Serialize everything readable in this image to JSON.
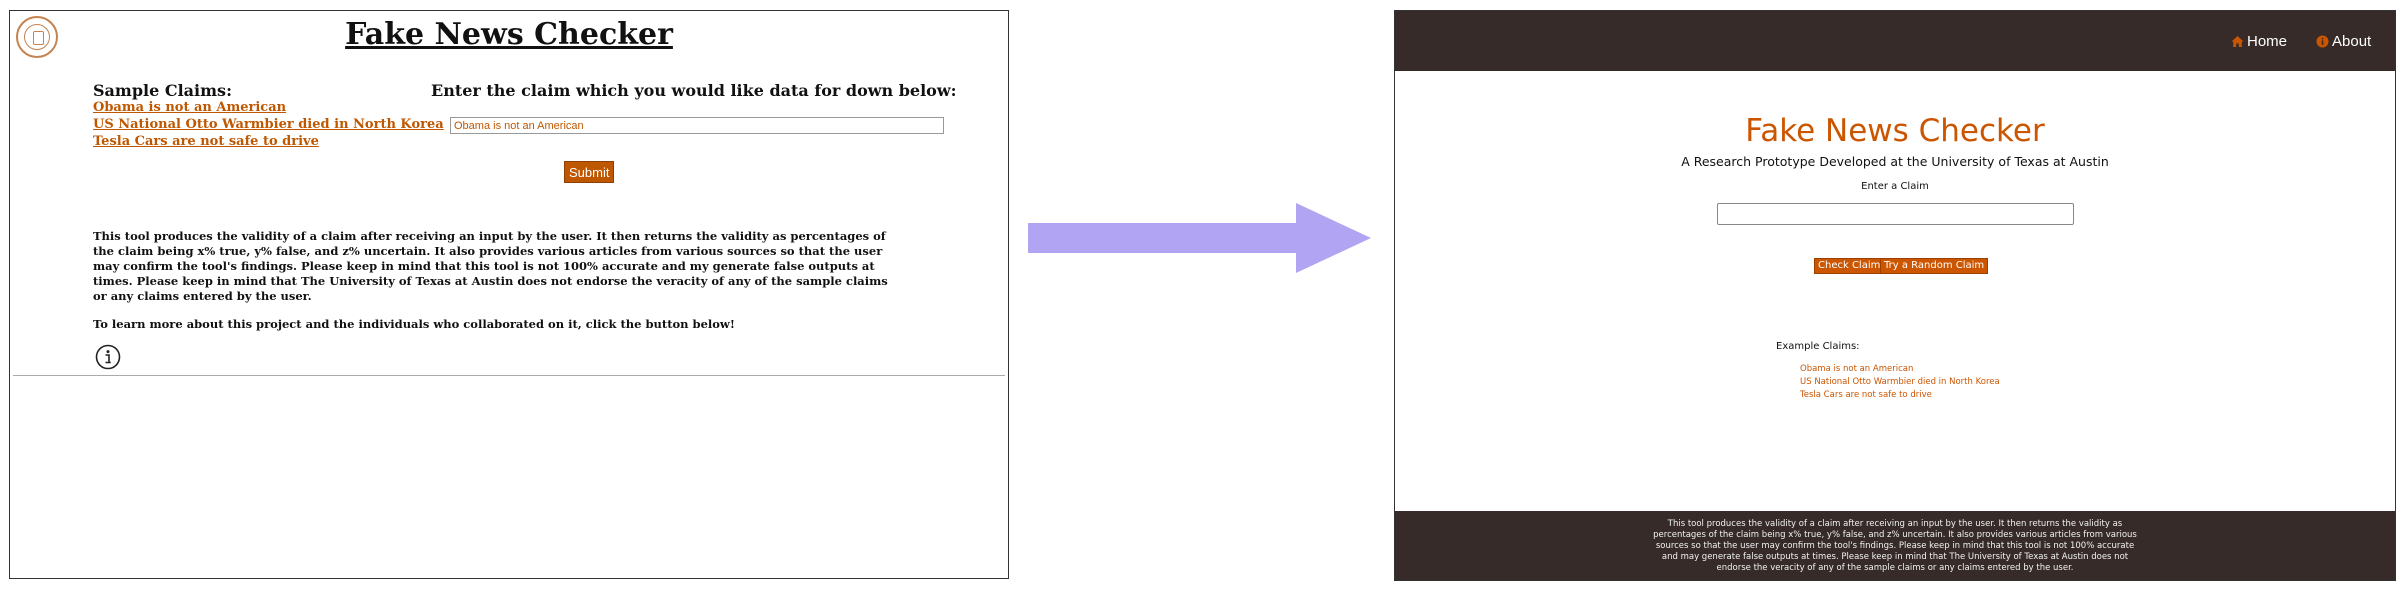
{
  "old_site": {
    "title": "Fake News Checker",
    "samples_heading": "Sample Claims:",
    "sample_claims": [
      "Obama is not an American",
      "US National Otto Warmbier died in North Korea",
      "Tesla Cars are not safe to drive"
    ],
    "prompt": "Enter the claim which you would like data for down below:",
    "input_value": "Obama is not an American",
    "submit_label": "Submit",
    "description": "This tool produces the validity of a claim after receiving an input by the user. It then returns the validity as percentages of the claim being x% true, y% false, and z% uncertain. It also provides various articles from various sources so that the user may confirm the tool's findings. Please keep in mind that this tool is not 100% accurate and my generate false outputs at times. Please keep in mind that The University of Texas at Austin does not endorse the veracity of any of the sample claims or any claims entered by the user.",
    "learn_more": "To learn more about this project and the individuals who collaborated on it, click the button below!",
    "info_icon": "info-circle-icon",
    "seal_icon": "university-seal-icon"
  },
  "arrow": {
    "icon": "right-arrow-icon",
    "color": "#b1a4f2"
  },
  "new_site": {
    "nav": {
      "home_label": "Home",
      "about_label": "About",
      "home_icon": "home-icon",
      "about_icon": "info-icon"
    },
    "title": "Fake News Checker",
    "subtitle": "A Research Prototype Developed at the University of Texas at Austin",
    "enter_label": "Enter a Claim",
    "input_value": "",
    "check_button_label": "Check Claim",
    "random_button_label": "Try a Random Claim",
    "examples_heading": "Example Claims:",
    "example_claims": [
      "Obama is not an American",
      "US National Otto Warmbier died in North Korea",
      "Tesla Cars are not safe to drive"
    ],
    "footer_text": "This tool produces the validity of a claim after receiving an input by the user. It then returns the validity as percentages of the claim being x% true, y% false, and z% uncertain. It also provides various articles from various sources so that the user may confirm the tool's findings. Please keep in mind that this tool is not 100% accurate and may generate false outputs at times. Please keep in mind that The University of Texas at Austin does not endorse the veracity of any of the sample claims or any claims entered by the user."
  },
  "colors": {
    "brand_orange": "#cc5500",
    "old_orange": "#bf5700",
    "dark_brown": "#362b29",
    "arrow_purple": "#b1a4f2"
  }
}
